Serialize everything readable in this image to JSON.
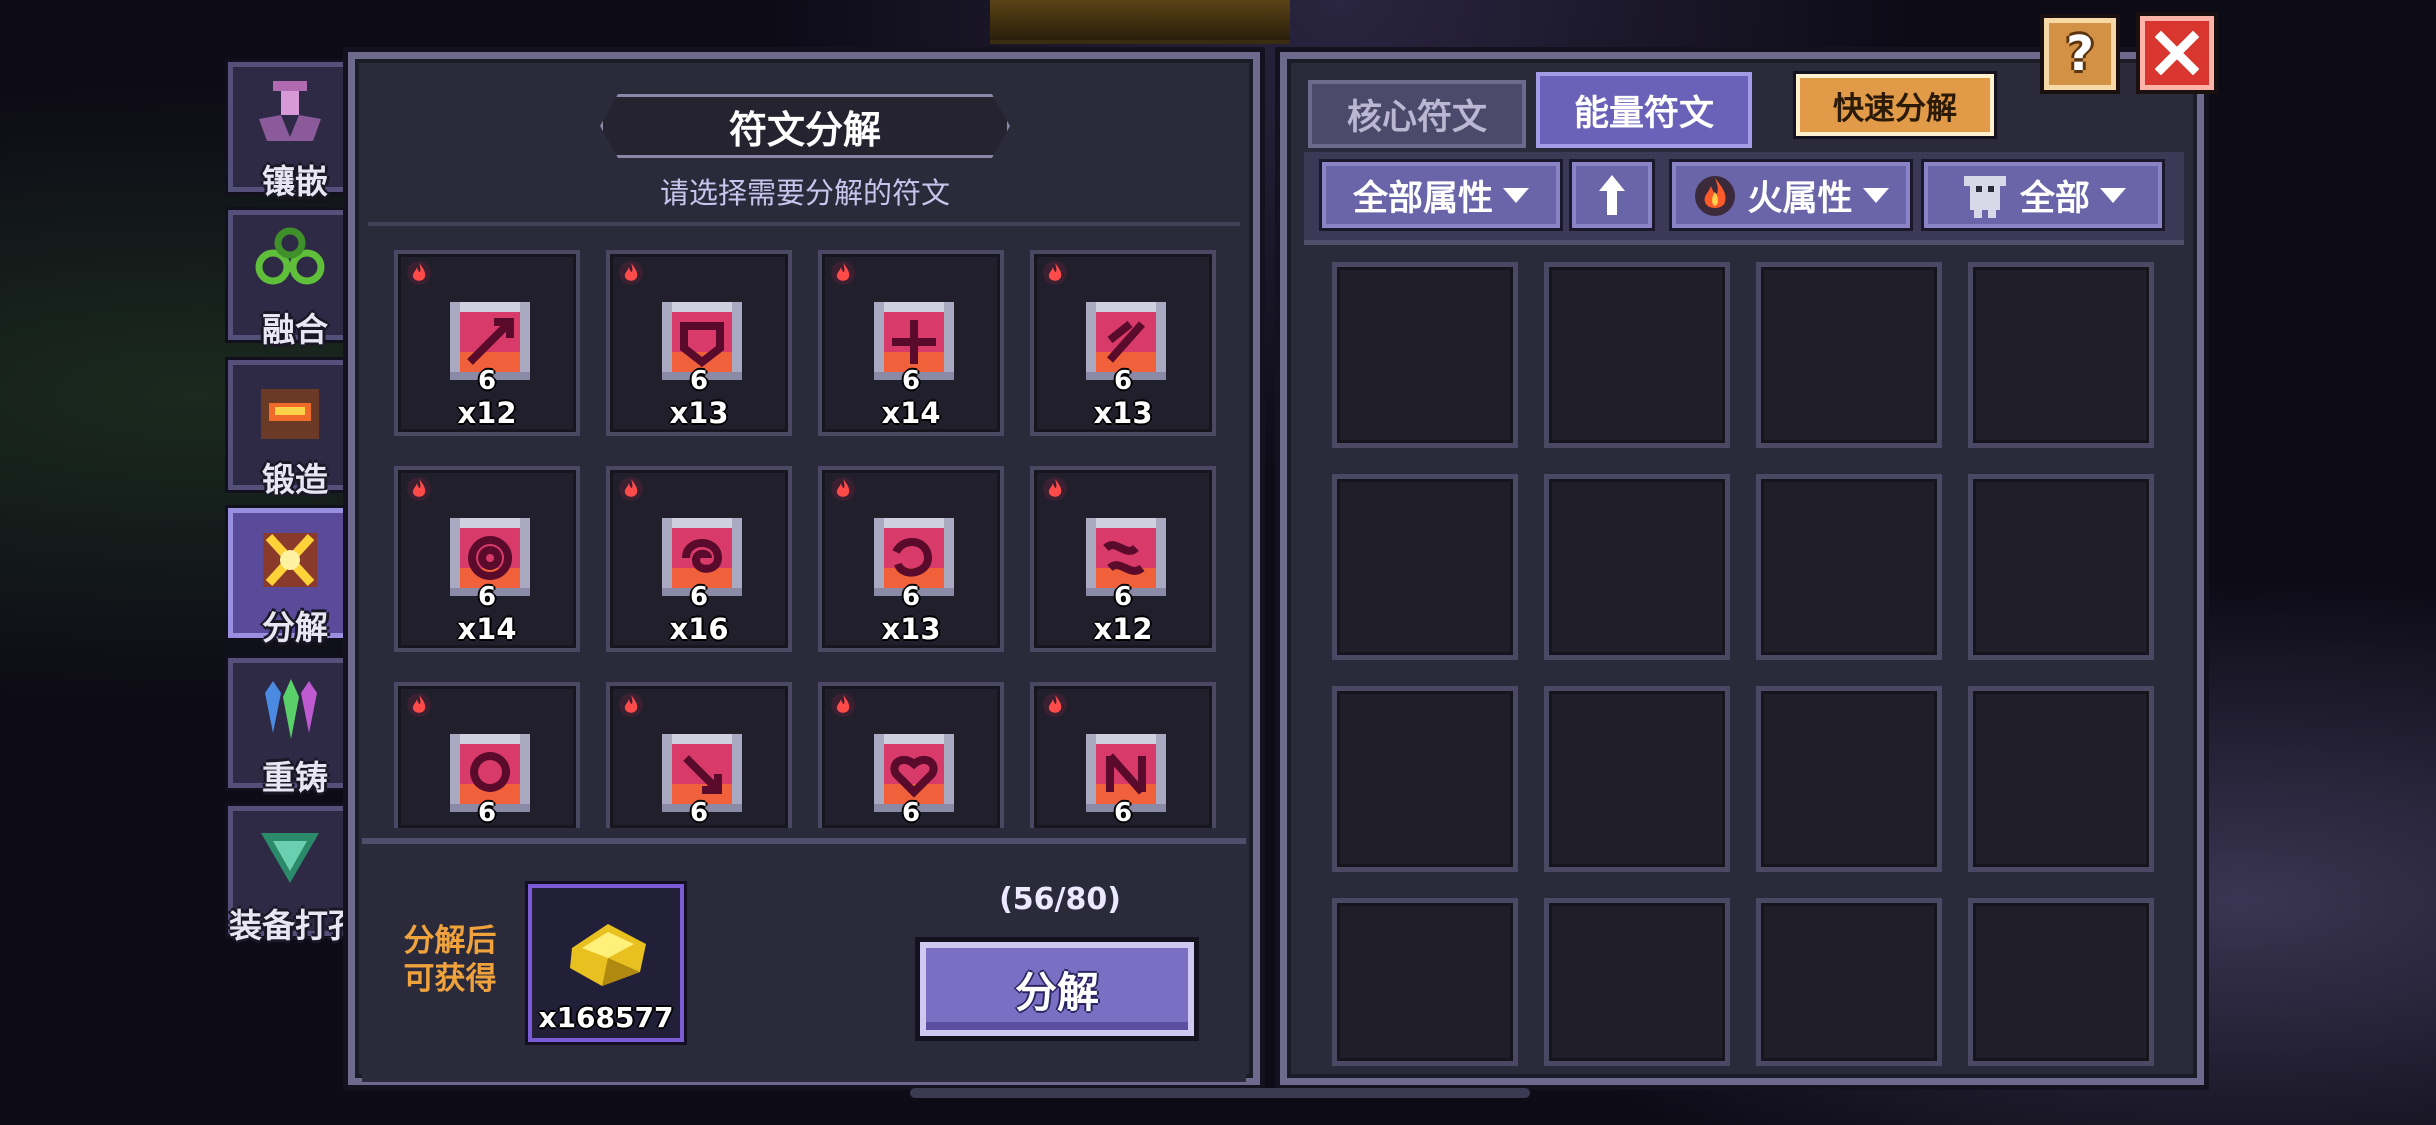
{
  "sidebar": {
    "items": [
      {
        "label": "镶嵌",
        "icon": "inlay-icon",
        "active": false
      },
      {
        "label": "融合",
        "icon": "fusion-icon",
        "active": false
      },
      {
        "label": "锻造",
        "icon": "forge-icon",
        "active": false
      },
      {
        "label": "分解",
        "icon": "decompose-icon",
        "active": true
      },
      {
        "label": "重铸",
        "icon": "recast-icon",
        "active": false
      },
      {
        "label": "装备打孔",
        "icon": "socket-drill-icon",
        "active": false
      }
    ]
  },
  "left_panel": {
    "title": "符文分解",
    "subtitle": "请选择需要分解的符文",
    "runes": [
      {
        "level": "6",
        "count": "x12",
        "icon": "rune-arrow-icon"
      },
      {
        "level": "6",
        "count": "x13",
        "icon": "rune-shield-icon"
      },
      {
        "level": "6",
        "count": "x14",
        "icon": "rune-cross-icon"
      },
      {
        "level": "6",
        "count": "x13",
        "icon": "rune-slash-icon"
      },
      {
        "level": "6",
        "count": "x14",
        "icon": "rune-ring-icon"
      },
      {
        "level": "6",
        "count": "x16",
        "icon": "rune-swirl-icon"
      },
      {
        "level": "6",
        "count": "x13",
        "icon": "rune-spiral-icon"
      },
      {
        "level": "6",
        "count": "x12",
        "icon": "rune-wave-icon"
      },
      {
        "level": "6",
        "count": "",
        "icon": "rune-orb-icon"
      },
      {
        "level": "6",
        "count": "",
        "icon": "rune-arrow-down-icon"
      },
      {
        "level": "6",
        "count": "",
        "icon": "rune-heart-icon"
      },
      {
        "level": "6",
        "count": "",
        "icon": "rune-bolt-icon"
      }
    ],
    "gain_label_line1": "分解后",
    "gain_label_line2": "可获得",
    "reward_count": "x168577",
    "reward_icon": "gold-dust-icon",
    "capacity": "(56/80)",
    "decompose_button": "分解"
  },
  "right_panel": {
    "tab_core": "核心符文",
    "tab_energy": "能量符文",
    "quick_decompose": "快速分解",
    "filter_attribute": "全部属性",
    "sort_icon": "arrow-up-icon",
    "filter_element": "火属性",
    "filter_type": "全部"
  },
  "help_label": "?",
  "colors": {
    "panel_bg": "#2b2a3b",
    "accent_purple": "#7a6fc2",
    "accent_orange": "#e09a48",
    "close_red": "#d8362e",
    "gain_text": "#f0a23c"
  }
}
